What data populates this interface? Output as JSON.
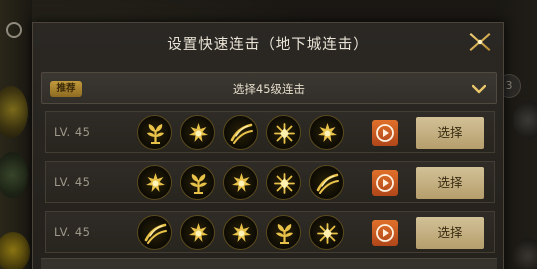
{
  "dialog": {
    "title": "设置快速连击（地下城连击）"
  },
  "dropdown": {
    "badge": "推荐",
    "label": "选择45级连击"
  },
  "combos": [
    {
      "level": "LV. 45",
      "skills": [
        "plant-skill-icon",
        "burst-skill-icon",
        "slash-skill-icon",
        "shatter-skill-icon",
        "burst-skill-icon"
      ],
      "select_label": "选择"
    },
    {
      "level": "LV. 45",
      "skills": [
        "burst-skill-icon",
        "plant-skill-icon",
        "burst-skill-icon",
        "shatter-skill-icon",
        "slash-skill-icon"
      ],
      "select_label": "选择"
    },
    {
      "level": "LV. 45",
      "skills": [
        "slash-skill-icon",
        "burst-skill-icon",
        "burst-skill-icon",
        "plant-skill-icon",
        "shatter-skill-icon"
      ],
      "select_label": "选择"
    }
  ],
  "side": {
    "right_badge": "3"
  },
  "colors": {
    "accent_gold": "#d9b44a",
    "play_orange": "#d9622a",
    "select_button": "#c8b486"
  }
}
